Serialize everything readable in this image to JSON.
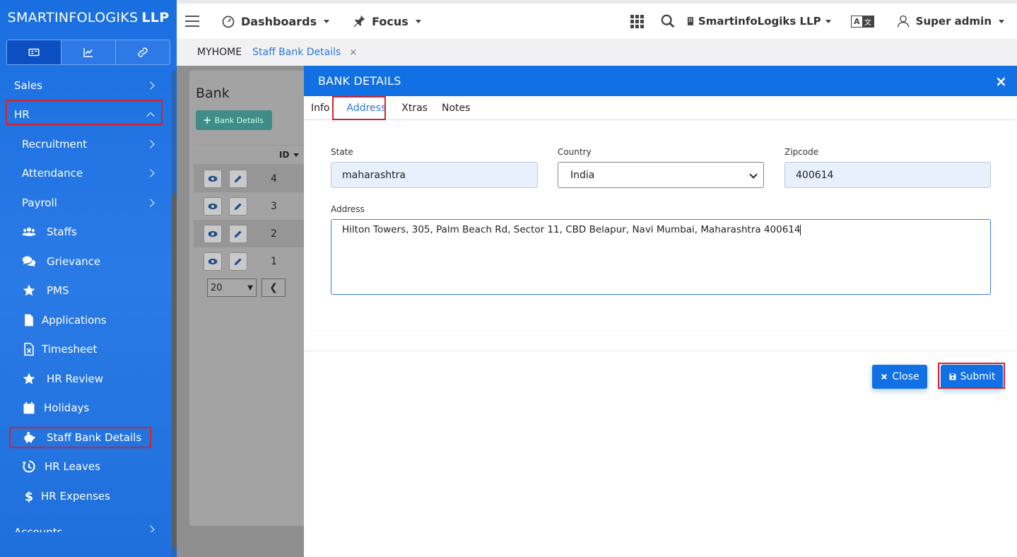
{
  "brand": {
    "name": "SMARTINFOLOGIKS",
    "suffix": "LLP"
  },
  "sidebar": {
    "items": [
      {
        "label": "Sales"
      },
      {
        "label": "HR"
      },
      {
        "label": "Recruitment"
      },
      {
        "label": "Attendance"
      },
      {
        "label": "Payroll"
      },
      {
        "label": "Staffs",
        "icon": "users-icon"
      },
      {
        "label": "Grievance",
        "icon": "comments-icon"
      },
      {
        "label": "PMS",
        "icon": "star-icon"
      },
      {
        "label": "Applications",
        "icon": "file-icon"
      },
      {
        "label": "Timesheet",
        "icon": "excel-file-icon"
      },
      {
        "label": "HR Review",
        "icon": "star-icon"
      },
      {
        "label": "Holidays",
        "icon": "calendar-icon"
      },
      {
        "label": "Staff Bank Details",
        "icon": "piggy-bank-icon"
      },
      {
        "label": "HR Leaves",
        "icon": "history-icon"
      },
      {
        "label": "HR Expenses",
        "icon": "dollar-icon"
      },
      {
        "label": "Accounts"
      }
    ]
  },
  "topbar": {
    "dashboards": "Dashboards",
    "focus": "Focus",
    "company": "SmartinfoLogiks LLP",
    "user": "Super admin"
  },
  "crumbs": {
    "home": "MYHOME",
    "current": "Staff Bank Details",
    "close": "×"
  },
  "background": {
    "title": "Bank",
    "add_button": "Bank Details",
    "id_header": "ID",
    "rows": [
      "4",
      "3",
      "2",
      "1"
    ],
    "page_size": "20"
  },
  "modal": {
    "title": "BANK DETAILS",
    "close": "×",
    "tabs": [
      "Info",
      "Address",
      "Xtras",
      "Notes"
    ],
    "fields": {
      "state_label": "State",
      "state_value": "maharashtra",
      "country_label": "Country",
      "country_value": "India",
      "zipcode_label": "Zipcode",
      "zipcode_value": "400614",
      "address_label": "Address",
      "address_value": "Hilton Towers, 305, Palm Beach Rd, Sector 11, CBD Belapur, Navi Mumbai, Maharashtra 400614"
    },
    "close_button": "Close",
    "submit_button": "Submit"
  },
  "colors": {
    "primary": "#1170e4",
    "highlight": "#d3252b",
    "link": "#2b78d8"
  }
}
